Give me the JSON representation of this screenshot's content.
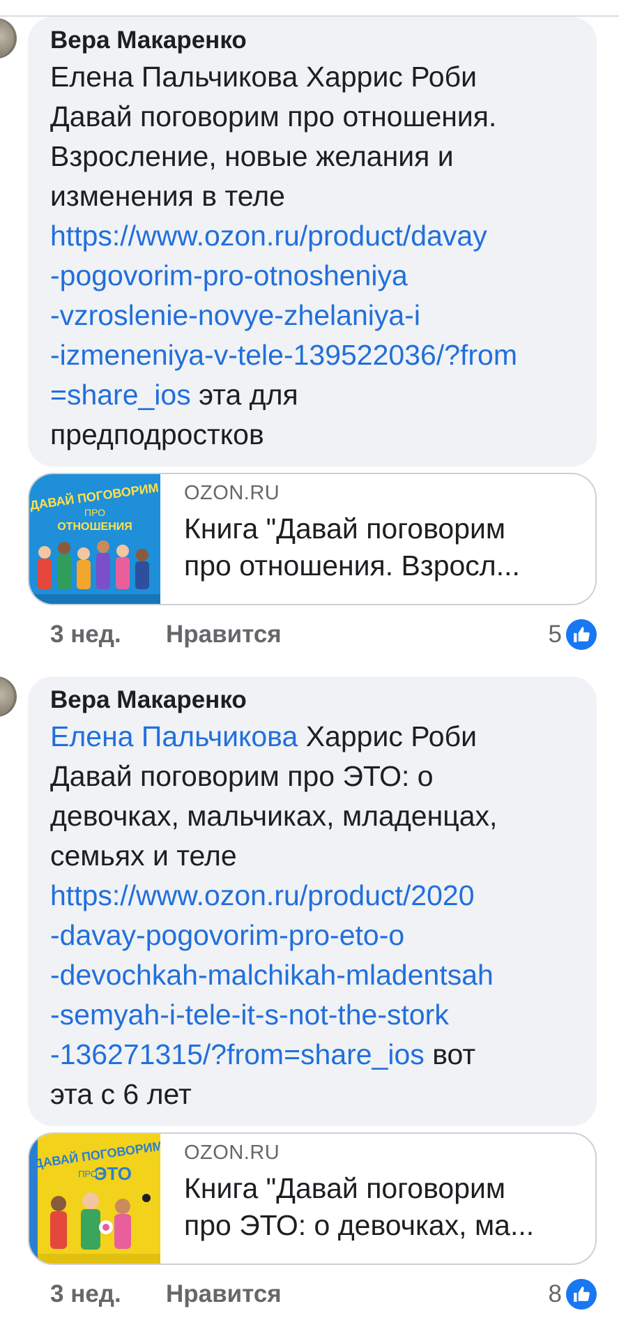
{
  "comments": [
    {
      "author": "Вера Макаренко",
      "mention": "",
      "text_lines": [
        "Елена Пальчикова Харрис Роби",
        "Давай поговорим про отношения.",
        "Взросление, новые желания и",
        "изменения в теле"
      ],
      "link_lines": [
        "https://www.ozon.ru/product/davay",
        "-pogovorim-pro-otnosheniya",
        "-vzroslenie-novye-zhelaniya-i",
        "-izmeneniya-v-tele-139522036/?from",
        "=share_ios"
      ],
      "link_tail": " эта для",
      "after_link_line": "предподростков",
      "preview": {
        "domain": "OZON.RU",
        "title_lines": [
          "Книга \"Давай поговорим",
          "про отношения. Взросл..."
        ],
        "cover_title": [
          "ДАВАЙ ПОГОВОРИМ",
          "ПРО",
          "ОТНОШЕНИЯ"
        ]
      },
      "time": "3 нед.",
      "like_label": "Нравится",
      "reaction_count": "5",
      "reaction_icon": "like-icon"
    },
    {
      "author": "Вера Макаренко",
      "mention": "Елена Пальчикова",
      "text_lines": [
        " Харрис Роби",
        "Давай поговорим про ЭТО: о",
        "девочках, мальчиках, младенцах,",
        "семьях и теле"
      ],
      "link_lines": [
        "https://www.ozon.ru/product/2020",
        "-davay-pogovorim-pro-eto-o",
        "-devochkah-malchikah-mladentsah",
        "-semyah-i-tele-it-s-not-the-stork",
        "-136271315/?from=share_ios"
      ],
      "link_tail": " вот",
      "after_link_line": "эта с 6 лет",
      "preview": {
        "domain": "OZON.RU",
        "title_lines": [
          "Книга \"Давай поговорим",
          "про ЭТО: о девочках, ма..."
        ],
        "cover_title": [
          "ДАВАЙ ПОГОВОРИМ",
          "ПРО",
          "ЭТО"
        ]
      },
      "time": "3 нед.",
      "like_label": "Нравится",
      "reaction_count": "8",
      "reaction_icon": "like-icon"
    }
  ],
  "colors": {
    "bubble": "#f0f2f5",
    "link": "#216fdb",
    "muted": "#65676b",
    "like_blue": "#1877f2",
    "cover1": "#1e8fd8",
    "cover2": "#f2d21b"
  }
}
